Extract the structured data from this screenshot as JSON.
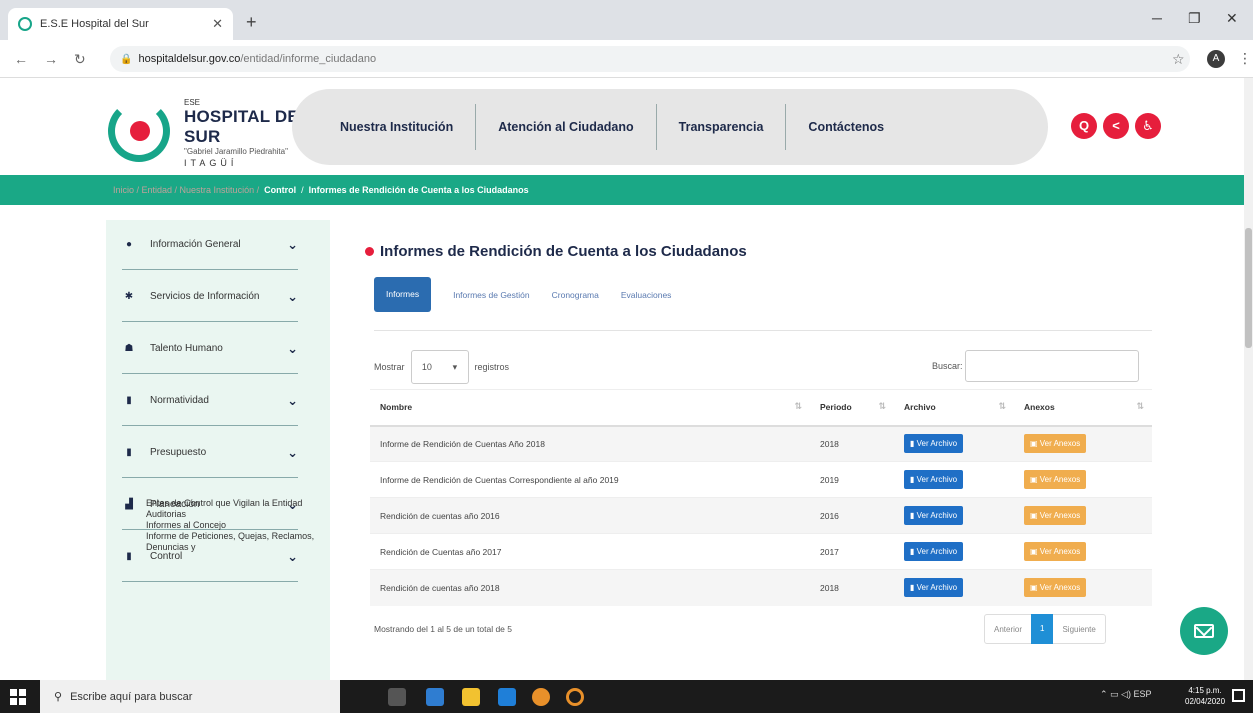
{
  "browser": {
    "tab_title": "E.S.E Hospital del Sur",
    "url_host": "hospitaldelsur.gov.co",
    "url_path": "/entidad/informe_ciudadano",
    "profile_initial": "A"
  },
  "logo": {
    "ese": "ESE",
    "name": "HOSPITAL DEL SUR",
    "sub": "\"Gabriel Jaramillo Piedrahita\"",
    "city": "ITAGÜÍ"
  },
  "nav": {
    "items": [
      "Nuestra Institución",
      "Atención al Ciudadano",
      "Transparencia",
      "Contáctenos"
    ]
  },
  "header_buttons": {
    "search": "Q",
    "share": "<",
    "accessibility": "♿"
  },
  "breadcrumb": {
    "faded": "Inicio / Entidad / Nuestra Institución /",
    "control": "Control",
    "sep": "/",
    "current": "Informes de Rendición de Cuenta a los Ciudadanos"
  },
  "sidebar": {
    "items": [
      {
        "icon": "●",
        "label": "Información General"
      },
      {
        "icon": "✱",
        "label": "Servicios de Información"
      },
      {
        "icon": "☗",
        "label": "Talento Humano"
      },
      {
        "icon": "▮",
        "label": "Normatividad"
      },
      {
        "icon": "▮",
        "label": "Presupuesto"
      },
      {
        "icon": "▟",
        "label": "Planeación"
      },
      {
        "icon": "▮",
        "label": "Control"
      }
    ],
    "sub_links": [
      "Entes de Control que Vigilan la Entidad",
      "Auditorias",
      "Informes al Concejo",
      "Informe de Peticiones, Quejas, Reclamos, Denuncias y"
    ]
  },
  "main": {
    "title": "Informes de Rendición de Cuenta a los Ciudadanos",
    "tabs": [
      "Informes",
      "Informes de Gestión",
      "Cronograma",
      "Evaluaciones"
    ],
    "show_label": "Mostrar",
    "show_value": "10",
    "records_label": "registros",
    "search_label": "Buscar:",
    "columns": [
      "Nombre",
      "Periodo",
      "Archivo",
      "Anexos"
    ],
    "rows": [
      {
        "name": "Informe de Rendición de Cuentas Año 2018",
        "period": "2018"
      },
      {
        "name": "Informe de Rendición de Cuentas Correspondiente al año 2019",
        "period": "2019"
      },
      {
        "name": "Rendición de cuentas año 2016",
        "period": "2016"
      },
      {
        "name": "Rendición de Cuentas año 2017",
        "period": "2017"
      },
      {
        "name": "Rendición de cuentas año 2018",
        "period": "2018"
      }
    ],
    "file_button": "Ver Archivo",
    "annex_button": "Ver Anexos",
    "info": "Mostrando del 1 al 5 de un total de 5",
    "pager": {
      "prev": "Anterior",
      "page": "1",
      "next": "Siguiente"
    }
  },
  "taskbar": {
    "search_placeholder": "Escribe aquí para buscar",
    "lang": "ESP",
    "time": "4:15 p.m.",
    "date": "02/04/2020"
  },
  "colors": {
    "brand_green": "#1aa886",
    "brand_red": "#e61e3c",
    "button_blue": "#1f6fc6",
    "button_orange": "#f0ad4e"
  }
}
